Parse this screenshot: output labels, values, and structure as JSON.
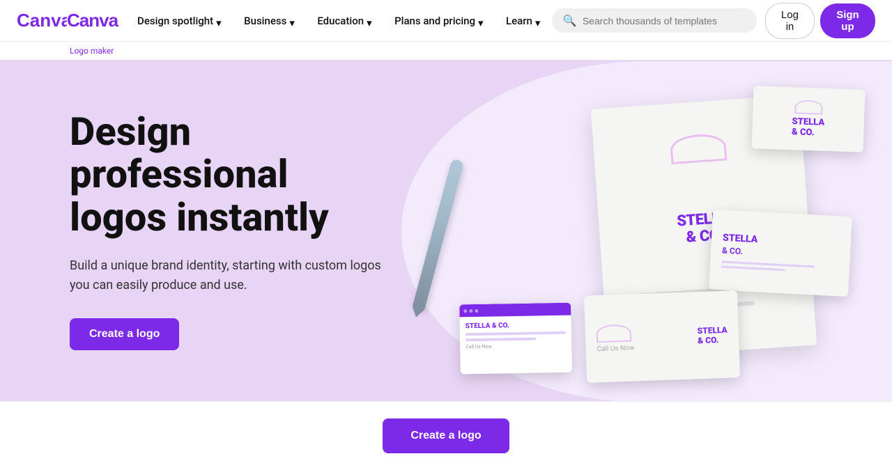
{
  "nav": {
    "logo_alt": "Canva",
    "items": [
      {
        "id": "design-spotlight",
        "label": "Design spotlight",
        "has_chevron": true
      },
      {
        "id": "business",
        "label": "Business",
        "has_chevron": true
      },
      {
        "id": "education",
        "label": "Education",
        "has_chevron": true
      },
      {
        "id": "plans-pricing",
        "label": "Plans and pricing",
        "has_chevron": true
      },
      {
        "id": "learn",
        "label": "Learn",
        "has_chevron": true
      }
    ],
    "search_placeholder": "Search thousands of templates",
    "login_label": "Log in",
    "signup_label": "Sign up"
  },
  "breadcrumb": {
    "text": "Logo maker"
  },
  "hero": {
    "title_line1": "Design professional",
    "title_line2": "logos instantly",
    "subtitle": "Build a unique brand identity, starting with custom logos you can easily produce and use.",
    "cta_label": "Create a logo",
    "bg_color": "#e8d5f5"
  },
  "bottom_cta": {
    "label": "Create a logo"
  },
  "brand": {
    "accent_color": "#7d2ae8",
    "accent_hover": "#6a1fd0"
  }
}
